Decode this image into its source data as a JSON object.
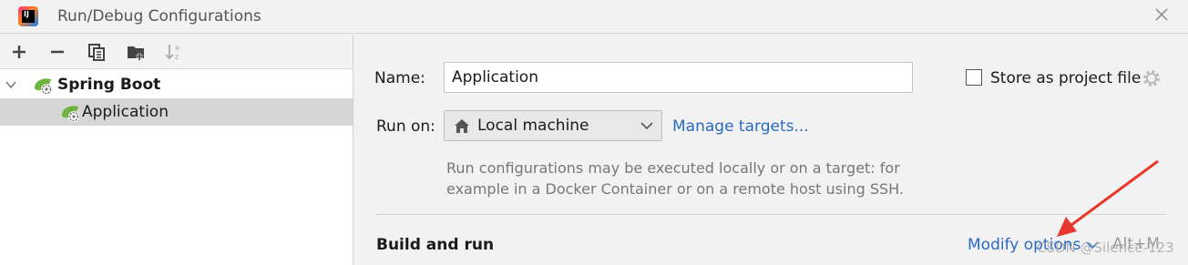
{
  "window": {
    "title": "Run/Debug Configurations"
  },
  "toolbar": {
    "icons": [
      "plus-icon",
      "minus-icon",
      "copy-icon",
      "new-folder-icon",
      "sort-alpha-icon"
    ]
  },
  "tree": {
    "group": {
      "label": "Spring Boot"
    },
    "items": [
      {
        "label": "Application"
      }
    ]
  },
  "form": {
    "name_label": "Name:",
    "name_value": "Application",
    "store_label": "Store as project file",
    "run_on_label": "Run on:",
    "run_on_value": "Local machine",
    "manage_targets": "Manage targets...",
    "help_line1": "Run configurations may be executed locally or on a target: for",
    "help_line2": "example in a Docker Container or on a remote host using SSH."
  },
  "build": {
    "title": "Build and run",
    "modify_options": "Modify options",
    "shortcut": "Alt+M"
  },
  "watermark": "CSDN @Silence-123",
  "colors": {
    "link": "#2a6ac2",
    "spring_green": "#6db33f",
    "annotation_arrow": "#e8372c"
  }
}
